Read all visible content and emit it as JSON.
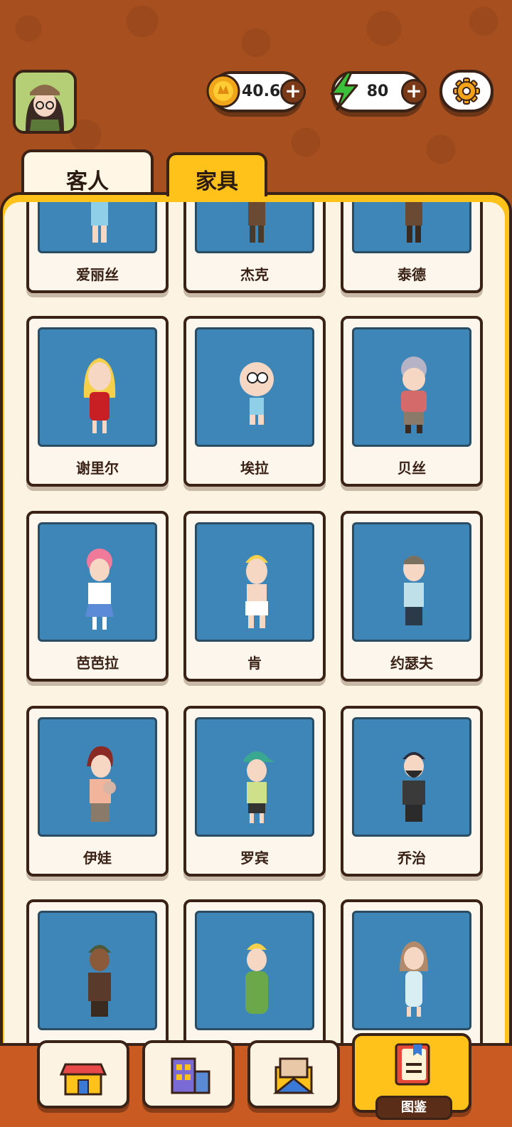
{
  "header": {
    "coins": {
      "value": "40.6K",
      "icon": "coin-icon"
    },
    "energy": {
      "value": "80",
      "icon": "lightning-icon"
    },
    "settings_icon": "gear-icon"
  },
  "tabs": [
    {
      "label": "客人",
      "selected": false
    },
    {
      "label": "家具",
      "selected": true
    }
  ],
  "characters": [
    {
      "name": "爱丽丝"
    },
    {
      "name": "杰克"
    },
    {
      "name": "泰德"
    },
    {
      "name": "谢里尔"
    },
    {
      "name": "埃拉"
    },
    {
      "name": "贝丝"
    },
    {
      "name": "芭芭拉"
    },
    {
      "name": "肯"
    },
    {
      "name": "约瑟夫"
    },
    {
      "name": "伊娃"
    },
    {
      "name": "罗宾"
    },
    {
      "name": "乔治"
    },
    {
      "name": ""
    },
    {
      "name": ""
    },
    {
      "name": ""
    }
  ],
  "bottom_nav": [
    {
      "icon": "shop-icon"
    },
    {
      "icon": "building-icon"
    },
    {
      "icon": "mail-icon"
    },
    {
      "icon": "book-icon",
      "label": "图鉴",
      "active": true
    }
  ],
  "colors": {
    "background": "#a84f1f",
    "panel": "#ffc21a",
    "portrait_bg": "#3f86b8",
    "outline": "#3a2316"
  }
}
